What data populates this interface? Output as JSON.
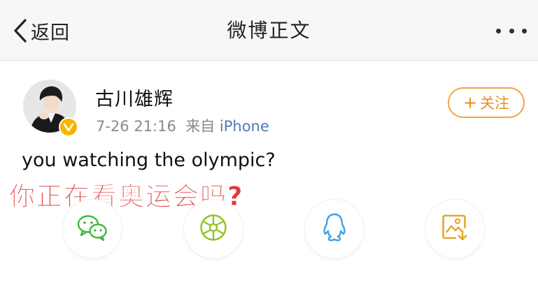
{
  "navbar": {
    "back_label": "返回",
    "title": "微博正文",
    "more_icon": "more-horizontal-icon"
  },
  "post": {
    "author": "古川雄辉",
    "time": "7-26 21:16",
    "source_prefix": "来自",
    "source_app": "iPhone",
    "verified": true,
    "follow_label": "关注",
    "follow_plus": "+",
    "text": "you watching the olympic?",
    "caption_overlay": "你正在看奥运会吗?"
  },
  "share": [
    {
      "icon": "wechat-icon",
      "color": "#3db83b"
    },
    {
      "icon": "moments-icon",
      "color": "#8fc31f"
    },
    {
      "icon": "qq-icon",
      "color": "#3aa0e8"
    },
    {
      "icon": "save-image-icon",
      "color": "#e6a62a"
    }
  ],
  "colors": {
    "accent_orange": "#f0a642",
    "link_blue": "#4f7cb4",
    "caption_red": "#e23a3a",
    "verified_gold": "#f7b500"
  }
}
